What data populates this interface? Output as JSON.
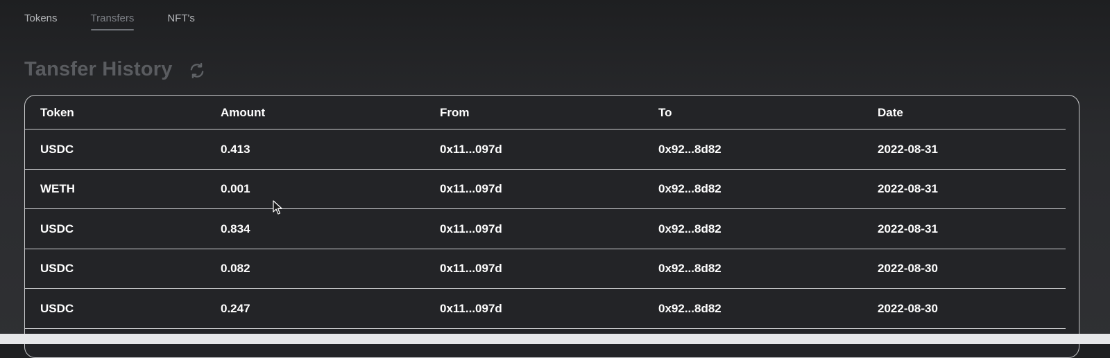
{
  "tabs": [
    {
      "label": "Tokens",
      "active": false
    },
    {
      "label": "Transfers",
      "active": true
    },
    {
      "label": "NFT's",
      "active": false
    }
  ],
  "page": {
    "title": "Tansfer History",
    "refresh_icon": "refresh-icon"
  },
  "table": {
    "headers": [
      "Token",
      "Amount",
      "From",
      "To",
      "Date"
    ],
    "rows": [
      {
        "token": "USDC",
        "amount": "0.413",
        "from": "0x11...097d",
        "to": "0x92...8d82",
        "date": "2022-08-31"
      },
      {
        "token": "WETH",
        "amount": "0.001",
        "from": "0x11...097d",
        "to": "0x92...8d82",
        "date": "2022-08-31"
      },
      {
        "token": "USDC",
        "amount": "0.834",
        "from": "0x11...097d",
        "to": "0x92...8d82",
        "date": "2022-08-31"
      },
      {
        "token": "USDC",
        "amount": "0.082",
        "from": "0x11...097d",
        "to": "0x92...8d82",
        "date": "2022-08-30"
      },
      {
        "token": "USDC",
        "amount": "0.247",
        "from": "0x11...097d",
        "to": "0x92...8d82",
        "date": "2022-08-30"
      }
    ]
  },
  "colors": {
    "background": "#2a2b2e",
    "title": "#5a5c60",
    "tab_inactive": "#b5b7ba",
    "tab_active": "#7d8086",
    "table_border": "#c9cacc",
    "text": "#ffffff"
  }
}
